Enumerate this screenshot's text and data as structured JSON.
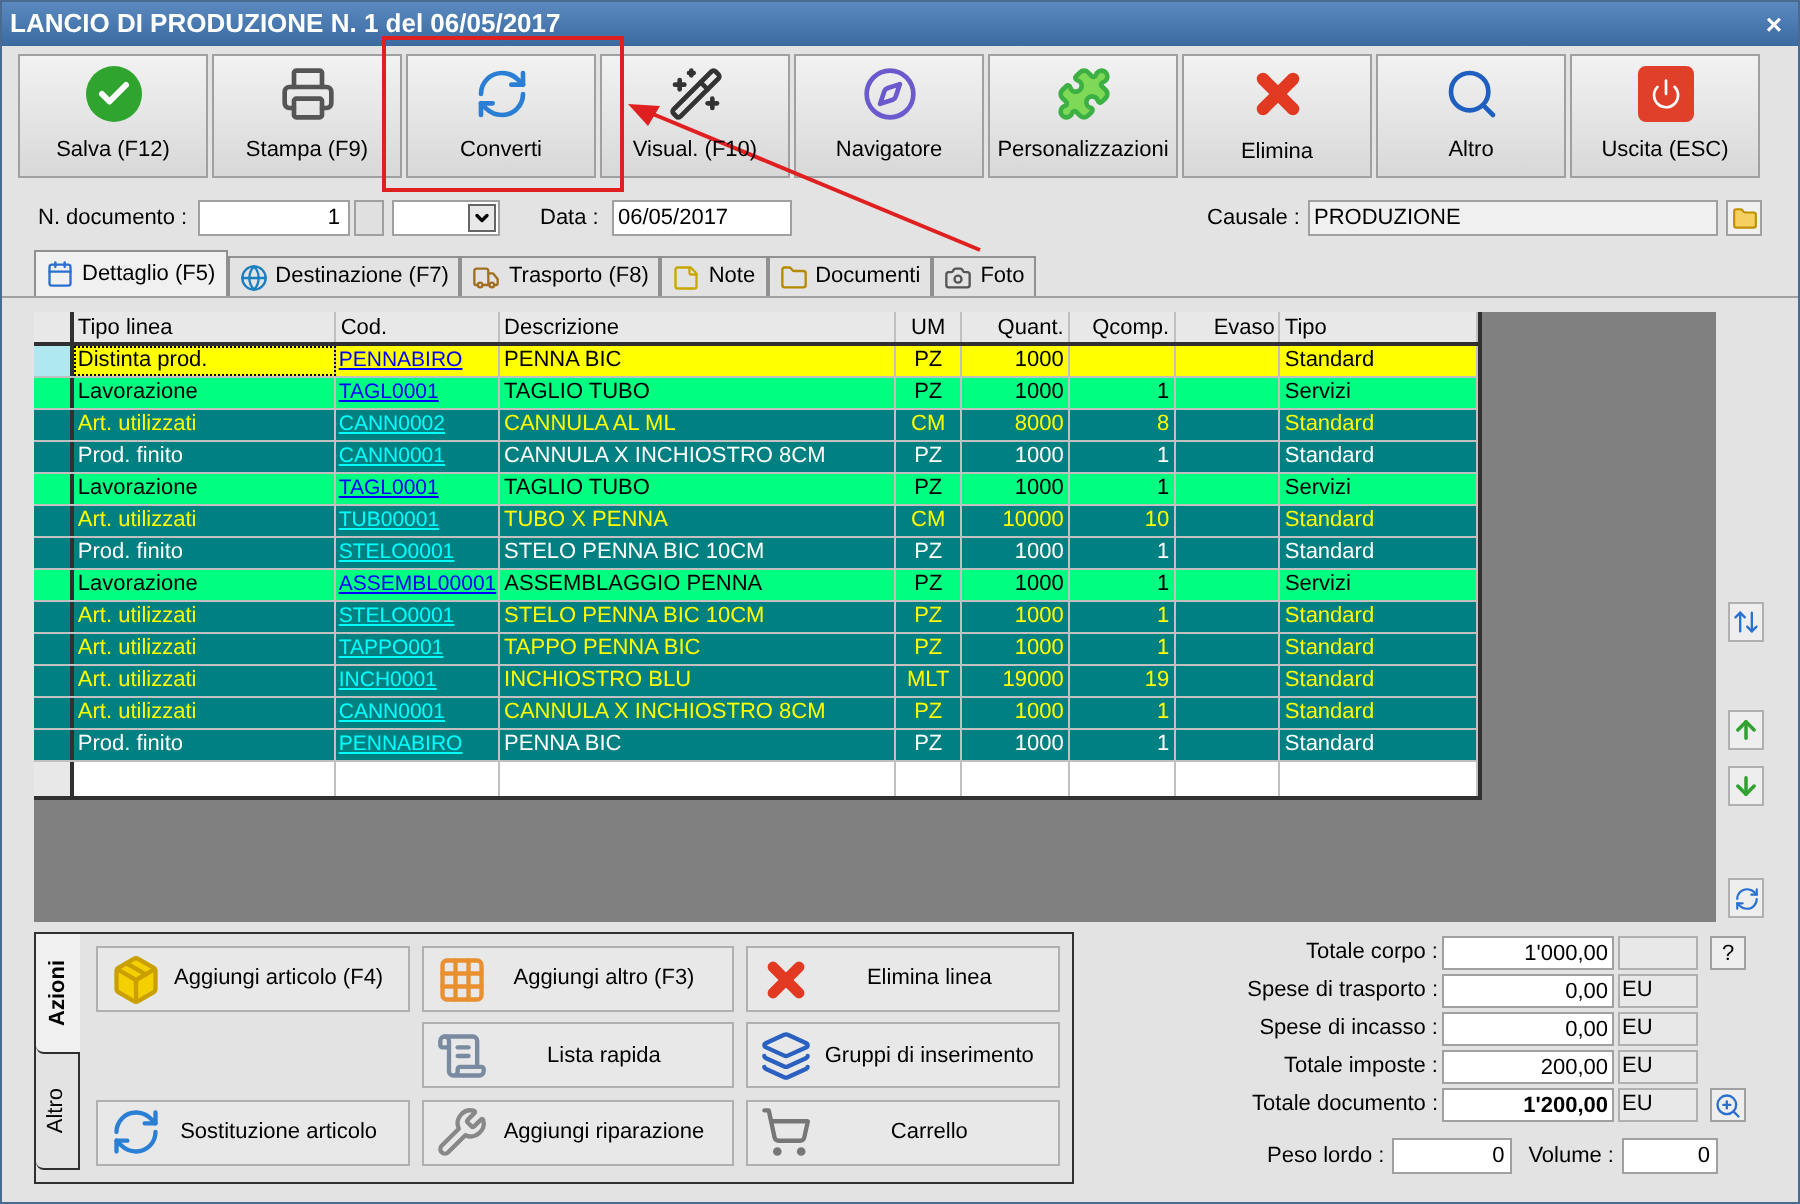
{
  "window": {
    "title": "LANCIO DI PRODUZIONE N. 1 del 06/05/2017",
    "close": "×"
  },
  "toolbar": [
    {
      "label": "Salva (F12)",
      "kind": "save"
    },
    {
      "label": "Stampa (F9)",
      "kind": "print"
    },
    {
      "label": "Converti",
      "kind": "convert"
    },
    {
      "label": "Visual. (F10)",
      "kind": "wand"
    },
    {
      "label": "Navigatore",
      "kind": "compass"
    },
    {
      "label": "Personalizzazioni",
      "kind": "puzzle"
    },
    {
      "label": "Elimina",
      "kind": "delete"
    },
    {
      "label": "Altro",
      "kind": "more"
    },
    {
      "label": "Uscita (ESC)",
      "kind": "exit"
    }
  ],
  "header": {
    "doc_label": "N. documento :",
    "doc_number": "1",
    "date_label": "Data :",
    "date": "06/05/2017",
    "causale_label": "Causale :",
    "causale": "PRODUZIONE"
  },
  "tabs": [
    {
      "label": "Dettaglio (F5)",
      "selected": true,
      "kind": "calendar"
    },
    {
      "label": "Destinazione (F7)",
      "selected": false,
      "kind": "globe"
    },
    {
      "label": "Trasporto (F8)",
      "selected": false,
      "kind": "truck"
    },
    {
      "label": "Note",
      "selected": false,
      "kind": "note"
    },
    {
      "label": "Documenti",
      "selected": false,
      "kind": "folder"
    },
    {
      "label": "Foto",
      "selected": false,
      "kind": "camera"
    }
  ],
  "table": {
    "columns": [
      "Tipo linea",
      "Cod.",
      "Descrizione",
      "UM",
      "Quant.",
      "Qcomp.",
      "Evaso",
      "Tipo"
    ],
    "rows": [
      {
        "kind": "distinta",
        "selected": true,
        "cells": [
          "Distinta prod.",
          "PENNABIRO",
          "PENNA BIC",
          "PZ",
          "1000",
          "",
          "",
          "Standard"
        ]
      },
      {
        "kind": "lavorazione",
        "selected": false,
        "cells": [
          "Lavorazione",
          "TAGL0001",
          "TAGLIO TUBO",
          "PZ",
          "1000",
          "1",
          "",
          "Servizi"
        ]
      },
      {
        "kind": "utilizzati",
        "selected": false,
        "cells": [
          "Art. utilizzati",
          "CANN0002",
          "CANNULA AL ML",
          "CM",
          "8000",
          "8",
          "",
          "Standard"
        ]
      },
      {
        "kind": "finito",
        "selected": false,
        "cells": [
          "Prod. finito",
          "CANN0001",
          "CANNULA X INCHIOSTRO 8CM",
          "PZ",
          "1000",
          "1",
          "",
          "Standard"
        ]
      },
      {
        "kind": "lavorazione",
        "selected": false,
        "cells": [
          "Lavorazione",
          "TAGL0001",
          "TAGLIO TUBO",
          "PZ",
          "1000",
          "1",
          "",
          "Servizi"
        ]
      },
      {
        "kind": "utilizzati",
        "selected": false,
        "cells": [
          "Art. utilizzati",
          "TUB00001",
          "TUBO X PENNA",
          "CM",
          "10000",
          "10",
          "",
          "Standard"
        ]
      },
      {
        "kind": "finito",
        "selected": false,
        "cells": [
          "Prod. finito",
          "STELO0001",
          "STELO PENNA BIC 10CM",
          "PZ",
          "1000",
          "1",
          "",
          "Standard"
        ]
      },
      {
        "kind": "lavorazione",
        "selected": false,
        "cells": [
          "Lavorazione",
          "ASSEMBL00001",
          "ASSEMBLAGGIO PENNA",
          "PZ",
          "1000",
          "1",
          "",
          "Servizi"
        ]
      },
      {
        "kind": "utilizzati",
        "selected": false,
        "cells": [
          "Art. utilizzati",
          "STELO0001",
          "STELO PENNA BIC 10CM",
          "PZ",
          "1000",
          "1",
          "",
          "Standard"
        ]
      },
      {
        "kind": "utilizzati",
        "selected": false,
        "cells": [
          "Art. utilizzati",
          "TAPPO001",
          "TAPPO PENNA BIC",
          "PZ",
          "1000",
          "1",
          "",
          "Standard"
        ]
      },
      {
        "kind": "utilizzati",
        "selected": false,
        "cells": [
          "Art. utilizzati",
          "INCH0001",
          "INCHIOSTRO BLU",
          "MLT",
          "19000",
          "19",
          "",
          "Standard"
        ]
      },
      {
        "kind": "utilizzati",
        "selected": false,
        "cells": [
          "Art. utilizzati",
          "CANN0001",
          "CANNULA X INCHIOSTRO 8CM",
          "PZ",
          "1000",
          "1",
          "",
          "Standard"
        ]
      },
      {
        "kind": "finito",
        "selected": false,
        "cells": [
          "Prod. finito",
          "PENNABIRO",
          "PENNA BIC",
          "PZ",
          "1000",
          "1",
          "",
          "Standard"
        ]
      }
    ]
  },
  "side_tabs": [
    {
      "label": "Azioni",
      "selected": true
    },
    {
      "label": "Altro",
      "selected": false
    }
  ],
  "actions": [
    {
      "label": "Aggiungi articolo (F4)",
      "kind": "box"
    },
    {
      "label": "Aggiungi altro (F3)",
      "kind": "grid"
    },
    {
      "label": "Elimina linea",
      "kind": "delete"
    },
    {
      "kind": "empty"
    },
    {
      "label": "Lista rapida",
      "kind": "scroll"
    },
    {
      "label": "Gruppi di inserimento",
      "kind": "group"
    },
    {
      "label": "Sostituzione articolo",
      "kind": "convert"
    },
    {
      "label": "Aggiungi riparazione",
      "kind": "wrench"
    },
    {
      "label": "Carrello",
      "kind": "cart"
    }
  ],
  "totals": [
    {
      "label": "Totale corpo :",
      "value": "1'000,00",
      "bold": false,
      "button": "?"
    },
    {
      "label": "Spese di trasporto :",
      "value": "0,00",
      "bold": false,
      "unit": "EU"
    },
    {
      "label": "Spese di incasso :",
      "value": "0,00",
      "bold": false,
      "unit": "EU"
    },
    {
      "label": "Totale imposte :",
      "value": "200,00",
      "bold": false,
      "unit": "EU"
    },
    {
      "label": "Totale documento :",
      "value": "1'200,00",
      "bold": true,
      "unit": "EU",
      "zoom": true
    }
  ],
  "weight": {
    "label": "Peso lordo :",
    "value": "0",
    "volume_label": "Volume :",
    "volume": "0"
  }
}
